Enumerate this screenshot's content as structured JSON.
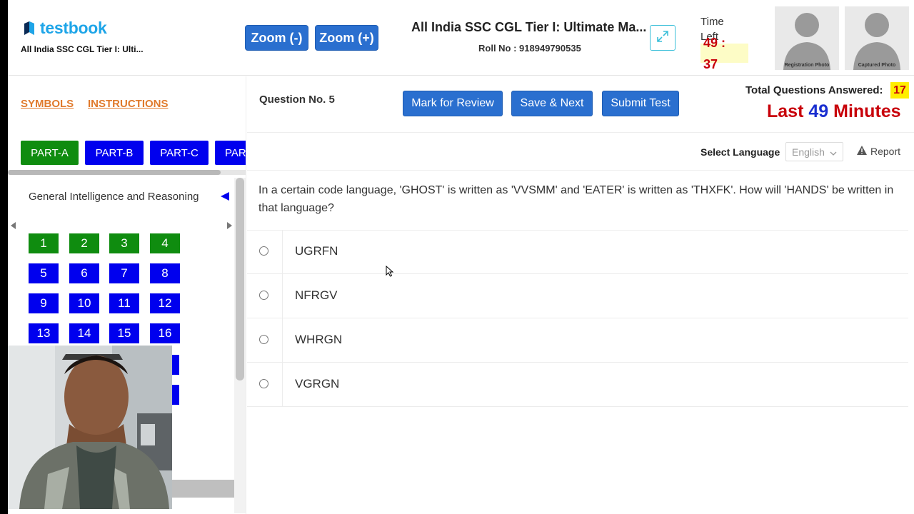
{
  "brand": {
    "name": "testbook",
    "exam_short": "All India SSC CGL Tier I: Ulti..."
  },
  "zoom": {
    "out_label": "Zoom (-)",
    "in_label": "Zoom (+)"
  },
  "exam": {
    "title": "All India SSC CGL Tier I: Ultimate Ma...",
    "roll": "Roll No : 918949790535"
  },
  "timer": {
    "label": "Time Left",
    "minutes": "49 :",
    "seconds": "37"
  },
  "photos": {
    "registration": "Registration Photo",
    "captured": "Captured Photo"
  },
  "links": {
    "symbols": "SYMBOLS",
    "instructions": "INSTRUCTIONS"
  },
  "parts": [
    {
      "label": "PART-A",
      "color": "#0f8c0f"
    },
    {
      "label": "PART-B",
      "color": "#0000ee"
    },
    {
      "label": "PART-C",
      "color": "#0000ee"
    },
    {
      "label": "PAR",
      "color": "#0000ee"
    }
  ],
  "section": {
    "name": "General Intelligence and Reasoning"
  },
  "palette": [
    {
      "n": "1",
      "color": "#0f8c0f"
    },
    {
      "n": "2",
      "color": "#0f8c0f"
    },
    {
      "n": "3",
      "color": "#0f8c0f"
    },
    {
      "n": "4",
      "color": "#0f8c0f"
    },
    {
      "n": "5",
      "color": "#0000ee"
    },
    {
      "n": "6",
      "color": "#0000ee"
    },
    {
      "n": "7",
      "color": "#0000ee"
    },
    {
      "n": "8",
      "color": "#0000ee"
    },
    {
      "n": "9",
      "color": "#0000ee"
    },
    {
      "n": "10",
      "color": "#0000ee"
    },
    {
      "n": "11",
      "color": "#0000ee"
    },
    {
      "n": "12",
      "color": "#0000ee"
    },
    {
      "n": "13",
      "color": "#0000ee"
    },
    {
      "n": "14",
      "color": "#0000ee"
    },
    {
      "n": "15",
      "color": "#0000ee"
    },
    {
      "n": "16",
      "color": "#0000ee"
    }
  ],
  "question_header": {
    "label": "Question No. 5"
  },
  "actions": {
    "mark": "Mark for Review",
    "save": "Save & Next",
    "submit": "Submit Test"
  },
  "stats": {
    "answered_label": "Total Questions Answered:",
    "answered_count": "17",
    "last_prefix": "Last",
    "last_number": "49",
    "last_suffix": "Minutes"
  },
  "language": {
    "label": "Select Language",
    "selected": "English"
  },
  "report": {
    "label": "Report"
  },
  "question": {
    "text": "In a certain code language, 'GHOST' is written as 'VVSMM' and 'EATER' is written as 'THXFK'. How will 'HANDS' be written in that language?"
  },
  "options": [
    "UGRFN",
    "NFRGV",
    "WHRGN",
    "VGRGN"
  ],
  "colors": {
    "accent": "#2a6fcf",
    "brand": "#1ea5e8",
    "alert": "#c8000a",
    "answered": "#0f8c0f",
    "not_answered": "#0000ee"
  }
}
